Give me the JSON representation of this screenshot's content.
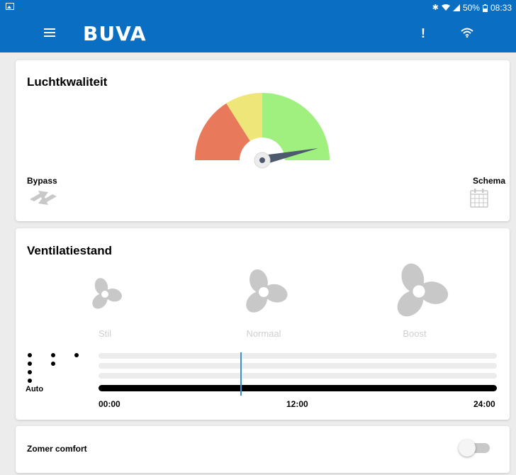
{
  "statusbar": {
    "battery_text": "50%",
    "time": "08:33",
    "icons": [
      "image-icon",
      "bluetooth-icon",
      "wifi-signal-icon",
      "cell-signal-icon",
      "battery-icon"
    ]
  },
  "appbar": {
    "logo": "BUVA",
    "alert_label": "!",
    "color": "#0a6fc2"
  },
  "air_quality": {
    "title": "Luchtkwaliteit",
    "gauge_colors": [
      "#e8795a",
      "#efe679",
      "#9ff07e"
    ],
    "bypass_label": "Bypass",
    "schema_label": "Schema"
  },
  "ventilation": {
    "title": "Ventilatiestand",
    "modes": [
      {
        "label": "Stil",
        "icon": "fan-small-icon"
      },
      {
        "label": "Normaal",
        "icon": "fan-medium-icon"
      },
      {
        "label": "Boost",
        "icon": "fan-large-icon"
      }
    ],
    "auto_label": "Auto",
    "timeline_labels": [
      "00:00",
      "12:00",
      "24:00"
    ]
  },
  "summer_comfort": {
    "label": "Zomer comfort",
    "enabled": false
  }
}
